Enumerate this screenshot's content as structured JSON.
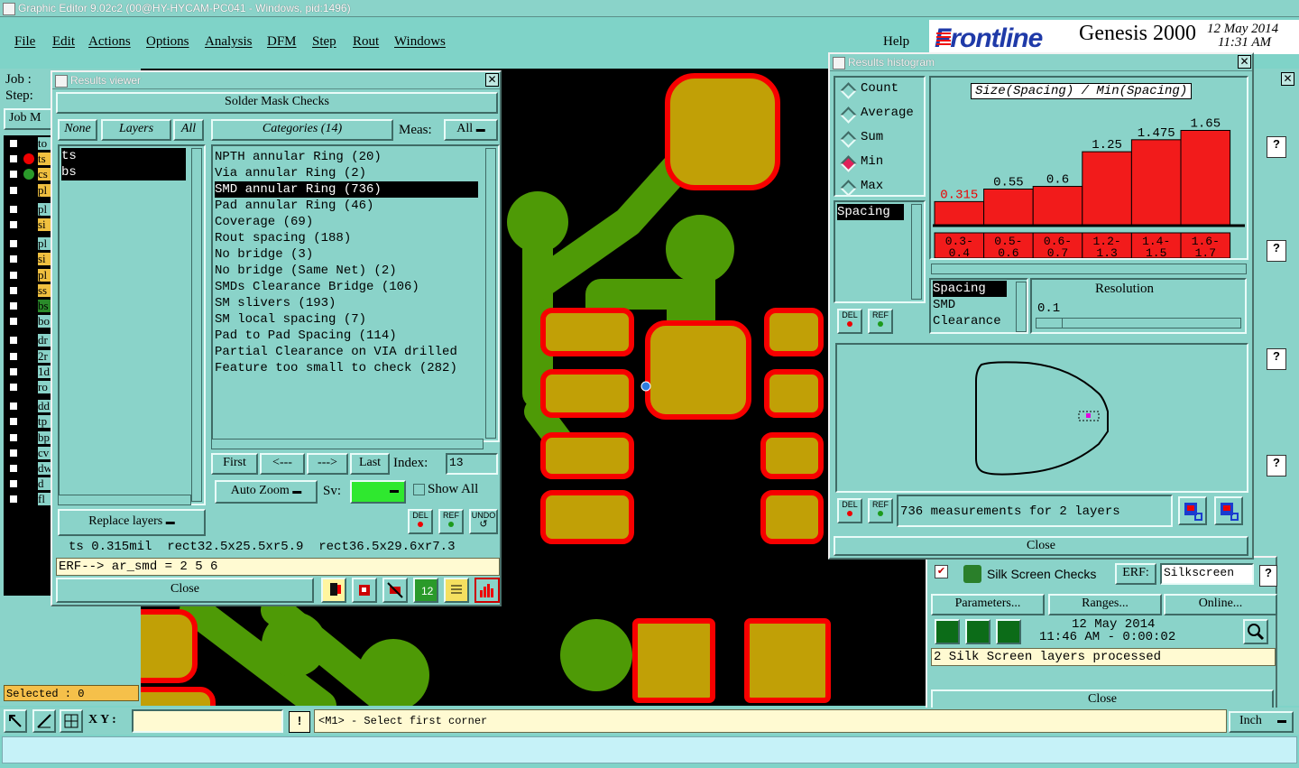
{
  "app": {
    "title": "Graphic Editor 9.02c2 (00@HY-HYCAM-PC041 - Windows, pid:1496)",
    "menu": [
      "File",
      "Edit",
      "Actions",
      "Options",
      "Analysis",
      "DFM",
      "Step",
      "Rout",
      "Windows"
    ],
    "help": "Help",
    "brand": "Frontline",
    "product": "Genesis 2000",
    "date": "12 May 2014",
    "time": "11:31 AM"
  },
  "left_panel": {
    "job_label": "Job :",
    "step_label": "Step:",
    "job_matrix_btn": "Job M",
    "layers": [
      "to",
      "ts",
      "cs",
      "pl",
      "pl",
      "si",
      "pl",
      "si",
      "pl",
      "ss",
      "bs",
      "bo",
      "dr",
      "2r",
      "1d",
      "ro",
      "dd",
      "tp",
      "bp",
      "cv",
      "dw",
      "d",
      "fl"
    ],
    "selected_label": "Selected : 0"
  },
  "results_viewer": {
    "title": "Results viewer",
    "header": "Solder Mask Checks",
    "none_btn": "None",
    "layers_btn": "Layers",
    "all_btn": "All",
    "layers": [
      "ts",
      "bs"
    ],
    "categories_btn": "Categories (14)",
    "meas_label": "Meas:",
    "meas_value": "All",
    "categories": [
      "NPTH annular Ring (20)",
      "Via annular Ring (2)",
      "SMD annular Ring (736)",
      "Pad annular Ring (46)",
      "Coverage (69)",
      "Rout spacing (188)",
      "No bridge (3)",
      "No bridge (Same Net) (2)",
      "SMDs Clearance Bridge (106)",
      "SM slivers (193)",
      "SM local spacing (7)",
      "Pad to Pad Spacing (114)",
      "Partial Clearance on VIA drilled",
      "Feature too small to check (282)"
    ],
    "selected_category_index": 2,
    "first_btn": "First",
    "prev_btn": "<---",
    "next_btn": "--->",
    "last_btn": "Last",
    "index_label": "Index:",
    "index_value": "13",
    "auto_zoom": "Auto Zoom",
    "sv_label": "Sv:",
    "show_all": "Show All",
    "replace_layers": "Replace layers",
    "del": "DEL",
    "ref": "REF",
    "undo": "UNDO",
    "status": "ts 0.315mil  rect32.5x25.5xr5.9  rect36.5x29.6xr7.3",
    "erf_line": "ERF--> ar_smd = 2 5 6",
    "close": "Close"
  },
  "histogram": {
    "title": "Results histogram",
    "modes": [
      "Count",
      "Average",
      "Sum",
      "Min",
      "Max"
    ],
    "selected_mode": "Min",
    "chart_title": "Size(Spacing) / Min(Spacing)",
    "list_item": "Spacing",
    "bars": [
      {
        "label": "0.315",
        "bin": "0.3-0.4"
      },
      {
        "label": "0.55",
        "bin": "0.5-0.6"
      },
      {
        "label": "0.6",
        "bin": "0.6-0.7"
      },
      {
        "label": "1.25",
        "bin": "1.2-1.3"
      },
      {
        "label": "1.475",
        "bin": "1.4-1.5"
      },
      {
        "label": "1.65",
        "bin": "1.6-1.7"
      }
    ],
    "types": [
      "Spacing",
      "SMD",
      "Clearance"
    ],
    "resolution_label": "Resolution",
    "resolution_value": "0.1",
    "measurements": "736 measurements for 2 layers",
    "close": "Close",
    "del": "DEL",
    "ref": "REF"
  },
  "checks_panel": {
    "name": "Silk Screen Checks",
    "erf_label": "ERF:",
    "erf_value": "Silkscreen",
    "parameters": "Parameters...",
    "ranges": "Ranges...",
    "online": "Online...",
    "date": "12 May 2014",
    "time": "11:46 AM - 0:00:02",
    "status": "2 Silk Screen layers processed",
    "close": "Close"
  },
  "bottom_bar": {
    "xy_label": "X Y :",
    "xy_value": "",
    "message": "<M1> - Select first corner",
    "units": "Inch"
  }
}
